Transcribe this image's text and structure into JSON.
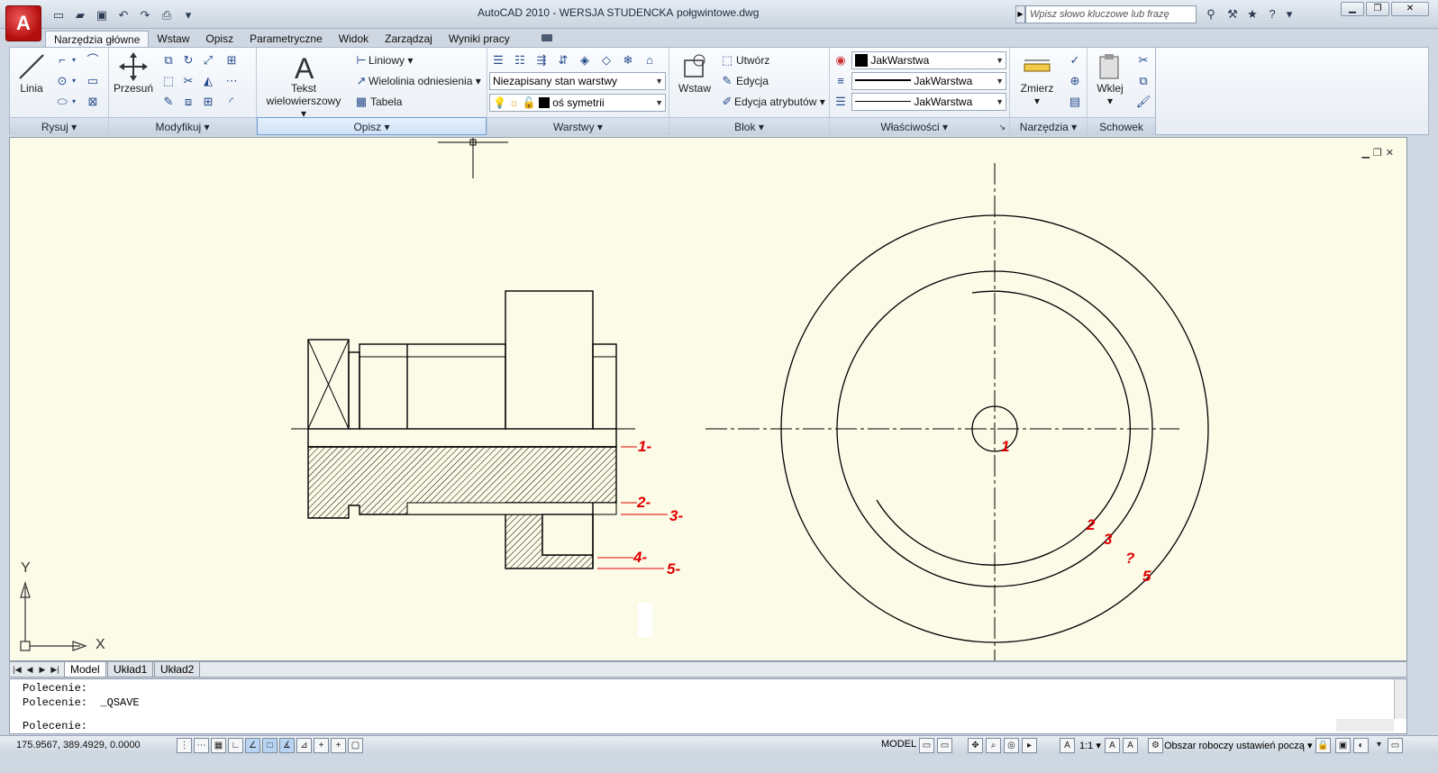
{
  "titlebar": {
    "app_title": "AutoCAD 2010 - WERSJA STUDENCKA",
    "doc_title": "połgwintowe.dwg",
    "search_placeholder": "Wpisz słowo kluczowe lub frazę"
  },
  "ribbon_tabs": [
    "Narzędzia główne",
    "Wstaw",
    "Opisz",
    "Parametryczne",
    "Widok",
    "Zarządzaj",
    "Wyniki pracy"
  ],
  "panels": {
    "draw": {
      "title": "Rysuj",
      "line_label": "Linia"
    },
    "modify": {
      "title": "Modyfikuj",
      "move_label": "Przesuń"
    },
    "annotation": {
      "title": "Opisz",
      "mtext_label": "Tekst",
      "mtext_label2": "wielowierszowy",
      "linear_label": "Liniowy",
      "multileader_label": "Wielolinia odniesienia",
      "table_label": "Tabela"
    },
    "layers": {
      "title": "Warstwy",
      "layer_state": "Niezapisany stan warstwy",
      "current_layer": "oś symetrii"
    },
    "block": {
      "title": "Blok",
      "insert_label": "Wstaw",
      "create_label": "Utwórz",
      "edit_label": "Edycja",
      "edit_attr_label": "Edycja atrybutów"
    },
    "properties": {
      "title": "Właściwości",
      "color": "JakWarstwa",
      "lineweight": "JakWarstwa",
      "linetype": "JakWarstwa"
    },
    "utilities": {
      "title": "Narzędzia",
      "measure_label": "Zmierz"
    },
    "clipboard": {
      "title": "Schowek",
      "paste_label": "Wklej"
    }
  },
  "drawing": {
    "left_labels": [
      "1",
      "2",
      "3",
      "4",
      "5"
    ],
    "right_labels": [
      "1",
      "2",
      "3",
      "?",
      "5"
    ],
    "ucs_y": "Y",
    "ucs_x": "X"
  },
  "layout_tabs": [
    "Model",
    "Układ1",
    "Układ2"
  ],
  "command": {
    "line1": "Polecenie:",
    "line2": "Polecenie:  _QSAVE",
    "line3": "Polecenie:"
  },
  "status": {
    "coords": "175.9567, 389.4929, 0.0000",
    "model": "MODEL",
    "scale": "1:1",
    "workspace": "Obszar roboczy ustawień począ"
  },
  "colors": {
    "drawing_bg": "#fbfbe8",
    "label_red": "#e00000",
    "accent": "#b30d0d"
  }
}
